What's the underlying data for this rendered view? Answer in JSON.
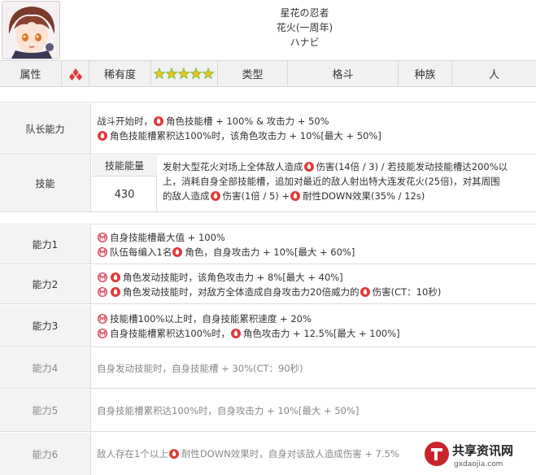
{
  "header": {
    "name_line1": "星花の忍者",
    "name_line2": "花火(一周年)",
    "name_line3": "ハナビ"
  },
  "info": {
    "attribute_label": "属性",
    "rarity_label": "稀有度",
    "type_label": "类型",
    "type_value": "格斗",
    "race_label": "种族",
    "race_value": "人",
    "rarity_stars": 5
  },
  "leader": {
    "label": "队长能力",
    "line1_a": "战斗开始时，",
    "line1_b": "角色技能槽 + 100% & 攻击力 + 50%",
    "line2_b": "角色技能槽累积达100%时，该角色攻击力 + 10%[最大 + 50%]"
  },
  "skill": {
    "label": "技能",
    "energy_label": "技能能量",
    "energy_value": "430",
    "line1_a": "发射大型花火对场上全体敌人造成",
    "line1_b": "伤害(14倍 / 3) / 若技能发动技能槽达200%以",
    "line2": "上，消耗自身全部技能槽，追加对最近的敌人射出特大连发花火(25倍)，对其周围",
    "line3_a": "的敌人造成",
    "line3_b": "伤害(1倍 / 5) +",
    "line3_c": "耐性DOWN效果(35% / 12s)"
  },
  "abilities": [
    {
      "label": "能力1",
      "line1": "自身技能槽最大值 + 100%",
      "line2_a": "队伍每编入1名",
      "line2_b": "角色，自身攻击力 + 10%[最大 + 60%]"
    },
    {
      "label": "能力2",
      "line1": "角色发动技能时，该角色攻击力 + 8%[最大 + 40%]",
      "line2_a": "角色发动技能时，对敌方全体造成自身攻击力20倍威力的",
      "line2_b": "伤害(CT：10秒)"
    },
    {
      "label": "能力3",
      "line1": "技能槽100%以上时，自身技能累积速度 + 20%",
      "line2_a": "自身技能槽累积达100%时，",
      "line2_b": "角色攻击力 + 12.5%[最大 + 100%]"
    },
    {
      "label": "能力4",
      "line1": "自身发动技能时，自身技能槽 + 30%(CT：90秒)"
    },
    {
      "label": "能力5",
      "line1": "自身技能槽累积达100%时，自身攻击力 + 10%[最大 + 50%]"
    },
    {
      "label": "能力6",
      "line1_a": "敌人存在1个以上",
      "line1_b": "耐性DOWN效果时，自身对该敌人造成伤害 + 7.5%"
    }
  ],
  "watermark": {
    "title": "共享资讯网",
    "sub": "gxdaojia.com"
  },
  "colors": {
    "fire_red": "#e03a3a",
    "m_icon": "#d8405a",
    "star_gold": "#f3c320",
    "label_bg": "#f3f3f3"
  }
}
